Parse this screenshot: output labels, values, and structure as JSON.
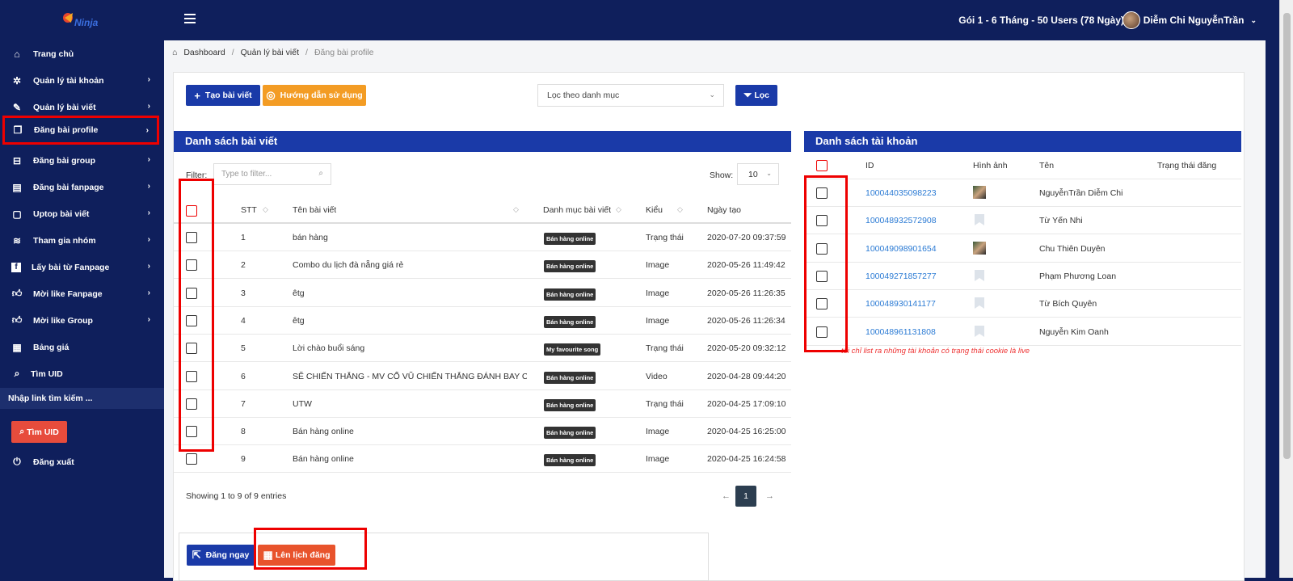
{
  "topbar": {
    "plan": "Gói 1 - 6 Tháng - 50 Users (78 Ngày)",
    "user_name": "Diễm Chi NguyễnTrần"
  },
  "sidebar": {
    "items": [
      {
        "label": "Trang chủ",
        "icon": "home-icon",
        "chevron": false
      },
      {
        "label": "Quản lý tài khoản",
        "icon": "gear-icon",
        "chevron": true
      },
      {
        "label": "Quản lý bài viết",
        "icon": "pencil-icon",
        "chevron": true
      },
      {
        "label": "Đăng bài profile",
        "icon": "copy-icon",
        "chevron": true,
        "active": true
      },
      {
        "label": "Đăng bài group",
        "icon": "group-icon",
        "chevron": true
      },
      {
        "label": "Đăng bài fanpage",
        "icon": "book-icon",
        "chevron": true
      },
      {
        "label": "Uptop bài viết",
        "icon": "clipboard-icon",
        "chevron": true
      },
      {
        "label": "Tham gia nhóm",
        "icon": "layers-icon",
        "chevron": true
      },
      {
        "label": "Lấy bài từ Fanpage",
        "icon": "facebook-icon",
        "chevron": true
      },
      {
        "label": "Mời like Fanpage",
        "icon": "thumbs-up-icon",
        "chevron": true
      },
      {
        "label": "Mời like Group",
        "icon": "thumbs-up-icon",
        "chevron": true
      },
      {
        "label": "Bảng giá",
        "icon": "calendar-icon",
        "chevron": false
      },
      {
        "label": "Tìm UID",
        "icon": "search-icon",
        "chevron": false
      }
    ],
    "search_placeholder": "Nhập link tìm kiếm ...",
    "find_uid_button": "Tìm UID",
    "logout_label": "Đăng xuất"
  },
  "breadcrumb": {
    "items": [
      "Dashboard",
      "Quản lý bài viết",
      "Đăng bài profile"
    ]
  },
  "toolbar": {
    "create_post": "Tạo bài viết",
    "guide": "Hướng dẫn sử dụng",
    "category_filter": "Lọc theo danh mục",
    "filter_button": "Lọc"
  },
  "posts_panel": {
    "title": "Danh sách bài viết",
    "filter_label": "Filter:",
    "filter_placeholder": "Type to filter...",
    "show_label": "Show:",
    "show_value": "10",
    "columns": [
      "STT",
      "Tên bài viết",
      "Danh mục bài viết",
      "Kiểu",
      "Ngày tạo"
    ],
    "rows": [
      {
        "stt": "1",
        "name": "bán hàng",
        "category": "Bán hàng online",
        "type": "Trạng thái",
        "date": "2020-07-20 09:37:59"
      },
      {
        "stt": "2",
        "name": "Combo du lịch đà nẵng giá rẻ",
        "category": "Bán hàng online",
        "type": "Image",
        "date": "2020-05-26 11:49:42"
      },
      {
        "stt": "3",
        "name": "êtg",
        "category": "Bán hàng online",
        "type": "Image",
        "date": "2020-05-26 11:26:35"
      },
      {
        "stt": "4",
        "name": "êtg",
        "category": "Bán hàng online",
        "type": "Image",
        "date": "2020-05-26 11:26:34"
      },
      {
        "stt": "5",
        "name": "Lời chào buổi sáng",
        "category": "My favourite song",
        "type": "Trạng thái",
        "date": "2020-05-20 09:32:12"
      },
      {
        "stt": "6",
        "name": "SẼ CHIẾN THẮNG - MV CỔ VŨ CHIẾN THẮNG ĐÁNH BAY COV...",
        "category": "Bán hàng online",
        "type": "Video",
        "date": "2020-04-28 09:44:20"
      },
      {
        "stt": "7",
        "name": "UTW",
        "category": "Bán hàng online",
        "type": "Trạng thái",
        "date": "2020-04-25 17:09:10"
      },
      {
        "stt": "8",
        "name": "Bán hàng online",
        "category": "Bán hàng online",
        "type": "Image",
        "date": "2020-04-25 16:25:00"
      },
      {
        "stt": "9",
        "name": "Bán hàng online",
        "category": "Bán hàng online",
        "type": "Image",
        "date": "2020-04-25 16:24:58"
      }
    ],
    "info": "Showing 1 to 9 of 9 entries",
    "page": "1",
    "prev": "←",
    "next": "→"
  },
  "accounts_panel": {
    "title": "Danh sách tài khoản",
    "columns": [
      "ID",
      "Hình ảnh",
      "Tên",
      "Trạng thái đăng"
    ],
    "rows": [
      {
        "id": "100044035098223",
        "name": "NguyễnTrần Diễm Chi",
        "avatar": "photo"
      },
      {
        "id": "100048932572908",
        "name": "Từ Yến Nhi",
        "avatar": "placeholder"
      },
      {
        "id": "100049098901654",
        "name": "Chu Thiên Duyên",
        "avatar": "photo"
      },
      {
        "id": "100049271857277",
        "name": "Phạm Phương Loan",
        "avatar": "placeholder"
      },
      {
        "id": "100048930141177",
        "name": "Từ Bích Quyên",
        "avatar": "placeholder"
      },
      {
        "id": "100048961131808",
        "name": "Nguyễn Kim Oanh",
        "avatar": "placeholder"
      }
    ],
    "note": "tối chỉ list ra những tài khoản có trạng thái cookie là live"
  },
  "actions": {
    "post_now": "Đăng ngay",
    "schedule": "Lên lịch đăng"
  },
  "colors": {
    "navy": "#0f1f5c",
    "blue": "#1a3aa8",
    "orange": "#f39c24",
    "red": "#e74c3c",
    "highlight": "#e00000"
  }
}
